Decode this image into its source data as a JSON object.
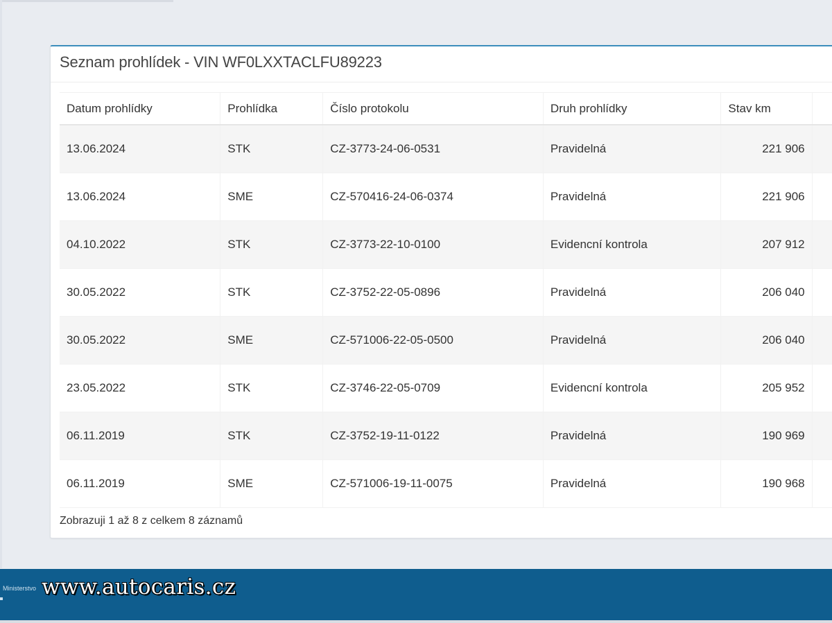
{
  "panel": {
    "title": "Seznam prohlídek - VIN WF0LXXTACLFU89223",
    "info": "Zobrazuji 1 až 8 z celkem 8 záznamů"
  },
  "table": {
    "headers": [
      "Datum prohlídky",
      "Prohlídka",
      "Číslo protokolu",
      "Druh prohlídky",
      "Stav km"
    ],
    "rows": [
      [
        "13.06.2024",
        "STK",
        "CZ-3773-24-06-0531",
        "Pravidelná",
        "221 906"
      ],
      [
        "13.06.2024",
        "SME",
        "CZ-570416-24-06-0374",
        "Pravidelná",
        "221 906"
      ],
      [
        "04.10.2022",
        "STK",
        "CZ-3773-22-10-0100",
        "Evidencní kontrola",
        "207 912"
      ],
      [
        "30.05.2022",
        "STK",
        "CZ-3752-22-05-0896",
        "Pravidelná",
        "206 040"
      ],
      [
        "30.05.2022",
        "SME",
        "CZ-571006-22-05-0500",
        "Pravidelná",
        "206 040"
      ],
      [
        "23.05.2022",
        "STK",
        "CZ-3746-22-05-0709",
        "Evidencní kontrola",
        "205 952"
      ],
      [
        "06.11.2019",
        "STK",
        "CZ-3752-19-11-0122",
        "Pravidelná",
        "190 969"
      ],
      [
        "06.11.2019",
        "SME",
        "CZ-571006-19-11-0075",
        "Pravidelná",
        "190 968"
      ]
    ]
  },
  "footer": {
    "ministry_text": "Ministerstvo",
    "watermark": "www.autocaris.cz"
  },
  "colors": {
    "footer_bg": "#0f5d8e",
    "panel_accent": "#3c8dbc",
    "page_bg": "#e9ecf1"
  }
}
